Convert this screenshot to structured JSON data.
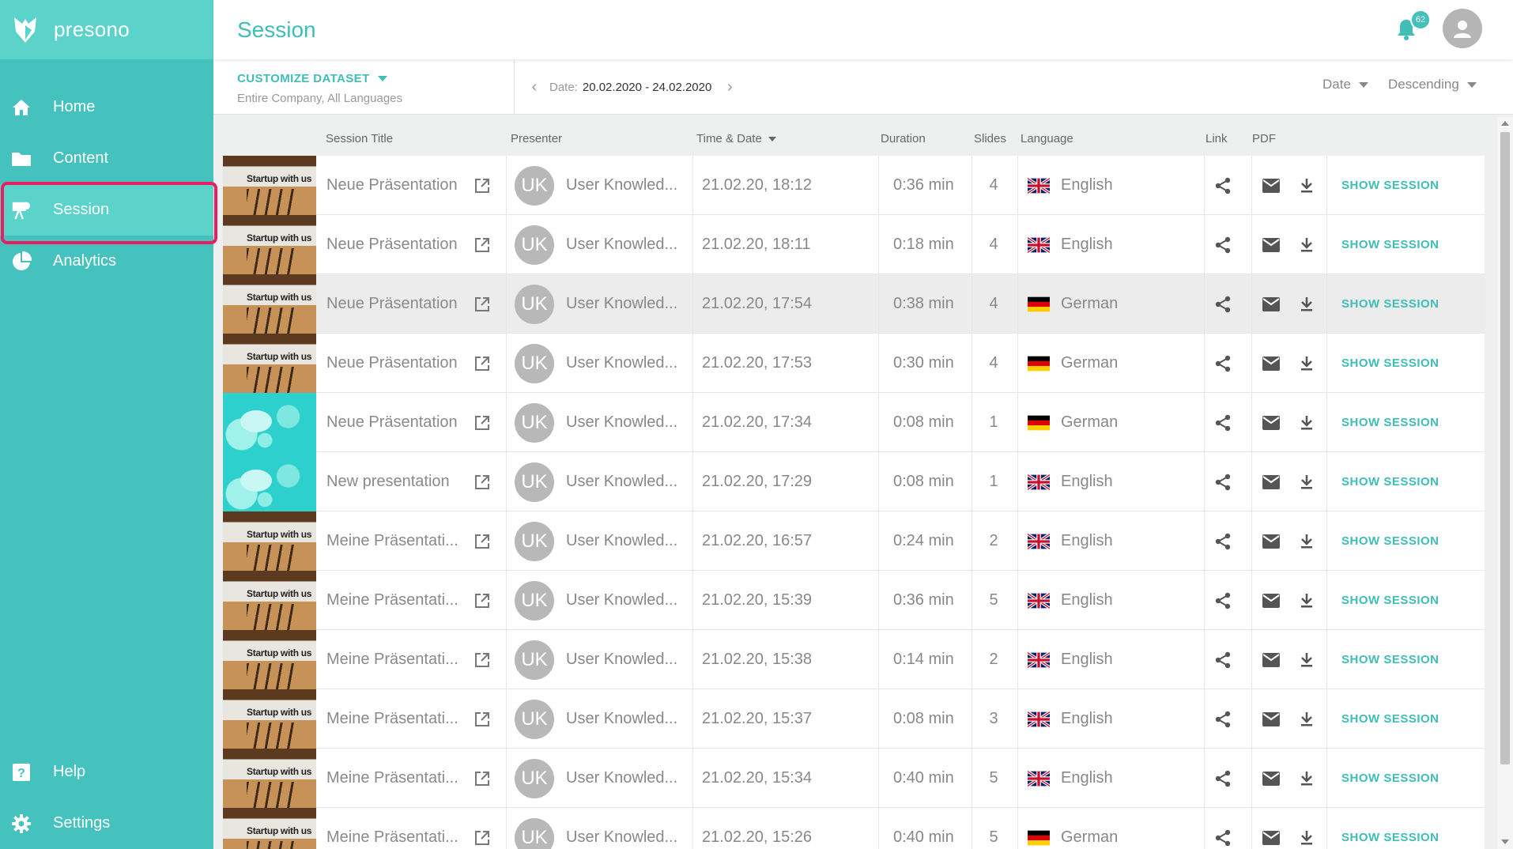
{
  "app": {
    "brand": "presono"
  },
  "header": {
    "title": "Session",
    "notification_count": "62"
  },
  "sidebar": {
    "items": [
      {
        "label": "Home",
        "icon": "home-icon"
      },
      {
        "label": "Content",
        "icon": "folder-icon"
      },
      {
        "label": "Session",
        "icon": "presentation-icon",
        "active": true
      },
      {
        "label": "Analytics",
        "icon": "pie-chart-icon"
      }
    ],
    "bottom_items": [
      {
        "label": "Help",
        "icon": "help-icon"
      },
      {
        "label": "Settings",
        "icon": "gear-icon"
      }
    ]
  },
  "filters": {
    "customize_label": "CUSTOMIZE DATASET",
    "customize_sub": "Entire Company,  All Languages",
    "date_label": "Date:",
    "date_range": "20.02.2020 - 24.02.2020",
    "sort_field": "Date",
    "sort_order": "Descending"
  },
  "table": {
    "columns": {
      "title": "Session Title",
      "presenter": "Presenter",
      "time": "Time & Date",
      "duration": "Duration",
      "slides": "Slides",
      "language": "Language",
      "link": "Link",
      "pdf": "PDF"
    },
    "action_label": "SHOW SESSION",
    "rows": [
      {
        "thumb": "startup",
        "thumb_text": "Startup with us",
        "title": "Neue Präsentation",
        "presenter_initials": "UK",
        "presenter": "User Knowled...",
        "time": "21.02.20, 18:12",
        "duration": "0:36 min",
        "slides": "4",
        "flag": "uk",
        "language": "English"
      },
      {
        "thumb": "startup",
        "thumb_text": "Startup with us",
        "title": "Neue Präsentation",
        "presenter_initials": "UK",
        "presenter": "User Knowled...",
        "time": "21.02.20, 18:11",
        "duration": "0:18 min",
        "slides": "4",
        "flag": "uk",
        "language": "English"
      },
      {
        "thumb": "startup",
        "thumb_text": "Startup with us",
        "title": "Neue Präsentation",
        "presenter_initials": "UK",
        "presenter": "User Knowled...",
        "time": "21.02.20, 17:54",
        "duration": "0:38 min",
        "slides": "4",
        "flag": "de",
        "language": "German",
        "hovered": true
      },
      {
        "thumb": "startup",
        "thumb_text": "Startup with us",
        "title": "Neue Präsentation",
        "presenter_initials": "UK",
        "presenter": "User Knowled...",
        "time": "21.02.20, 17:53",
        "duration": "0:30 min",
        "slides": "4",
        "flag": "de",
        "language": "German"
      },
      {
        "thumb": "cyan",
        "thumb_text": "",
        "title": "Neue Präsentation",
        "presenter_initials": "UK",
        "presenter": "User Knowled...",
        "time": "21.02.20, 17:34",
        "duration": "0:08 min",
        "slides": "1",
        "flag": "de",
        "language": "German"
      },
      {
        "thumb": "cyan",
        "thumb_text": "",
        "title": "New presentation",
        "presenter_initials": "UK",
        "presenter": "User Knowled...",
        "time": "21.02.20, 17:29",
        "duration": "0:08 min",
        "slides": "1",
        "flag": "uk",
        "language": "English"
      },
      {
        "thumb": "startup",
        "thumb_text": "Startup with us",
        "title": "Meine Präsentati...",
        "presenter_initials": "UK",
        "presenter": "User Knowled...",
        "time": "21.02.20, 16:57",
        "duration": "0:24 min",
        "slides": "2",
        "flag": "uk",
        "language": "English"
      },
      {
        "thumb": "startup",
        "thumb_text": "Startup with us",
        "title": "Meine Präsentati...",
        "presenter_initials": "UK",
        "presenter": "User Knowled...",
        "time": "21.02.20, 15:39",
        "duration": "0:36 min",
        "slides": "5",
        "flag": "uk",
        "language": "English"
      },
      {
        "thumb": "startup",
        "thumb_text": "Startup with us",
        "title": "Meine Präsentati...",
        "presenter_initials": "UK",
        "presenter": "User Knowled...",
        "time": "21.02.20, 15:38",
        "duration": "0:14 min",
        "slides": "2",
        "flag": "uk",
        "language": "English"
      },
      {
        "thumb": "startup",
        "thumb_text": "Startup with us",
        "title": "Meine Präsentati...",
        "presenter_initials": "UK",
        "presenter": "User Knowled...",
        "time": "21.02.20, 15:37",
        "duration": "0:08 min",
        "slides": "3",
        "flag": "uk",
        "language": "English"
      },
      {
        "thumb": "startup",
        "thumb_text": "Startup with us",
        "title": "Meine Präsentati...",
        "presenter_initials": "UK",
        "presenter": "User Knowled...",
        "time": "21.02.20, 15:34",
        "duration": "0:40 min",
        "slides": "5",
        "flag": "uk",
        "language": "English"
      },
      {
        "thumb": "startup",
        "thumb_text": "Startup with us",
        "title": "Meine Präsentati...",
        "presenter_initials": "UK",
        "presenter": "User Knowled...",
        "time": "21.02.20, 15:26",
        "duration": "0:40 min",
        "slides": "5",
        "flag": "de",
        "language": "German"
      }
    ]
  },
  "colors": {
    "accent": "#3fbdb6",
    "sidebar": "#45c2bd",
    "sidebar_active": "#5bd3cb",
    "highlight": "#e8205f"
  }
}
